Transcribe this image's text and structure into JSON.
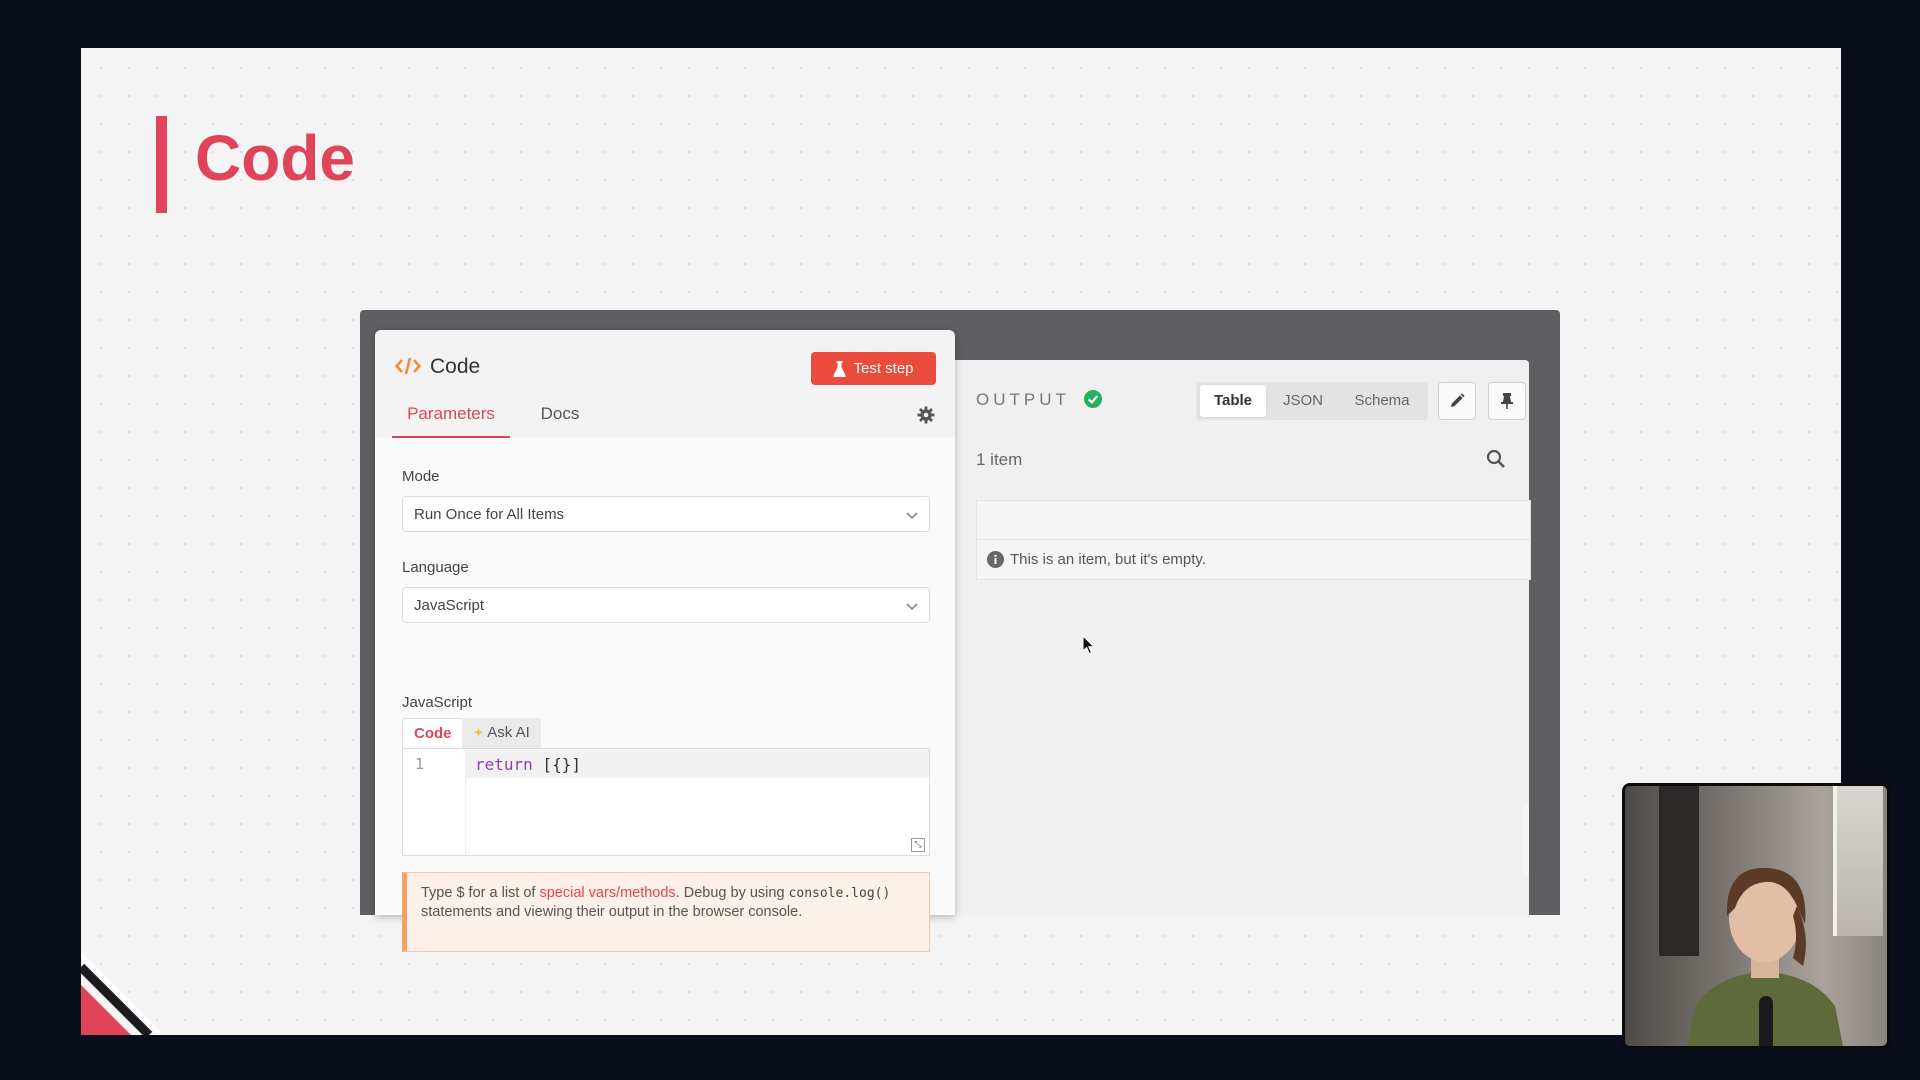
{
  "slide": {
    "title": "Code"
  },
  "node": {
    "title": "Code",
    "test_button": "Test step",
    "tabs": [
      "Parameters",
      "Docs"
    ],
    "active_tab": "Parameters",
    "mode": {
      "label": "Mode",
      "value": "Run Once for All Items"
    },
    "language": {
      "label": "Language",
      "value": "JavaScript"
    },
    "editor": {
      "label": "JavaScript",
      "tabs": [
        "Code",
        "Ask AI"
      ],
      "active_tab": "Code",
      "lines": [
        {
          "number": "1",
          "keyword": "return",
          "rest": " [{}]"
        }
      ]
    },
    "hint": {
      "prefix": "Type $ for a list of ",
      "link": "special vars/methods",
      "middle": ". Debug by using ",
      "code": "console.log()",
      "suffix": " statements and viewing their output in the browser console."
    }
  },
  "output": {
    "label": "OUTPUT",
    "views": [
      "Table",
      "JSON",
      "Schema"
    ],
    "active_view": "Table",
    "item_count": "1 item",
    "empty_message": "This is an item, but it's empty."
  },
  "colors": {
    "accent": "#e0445a",
    "button": "#ea4b3c",
    "success": "#27ae60",
    "code_icon": "#f08c3a"
  },
  "icons": [
    "code-icon",
    "flask-icon",
    "gear-icon",
    "chevron-down-icon",
    "sparkle-icon",
    "resize-icon",
    "check-circle-icon",
    "pencil-icon",
    "pin-icon",
    "search-icon",
    "info-icon",
    "cursor-icon"
  ]
}
